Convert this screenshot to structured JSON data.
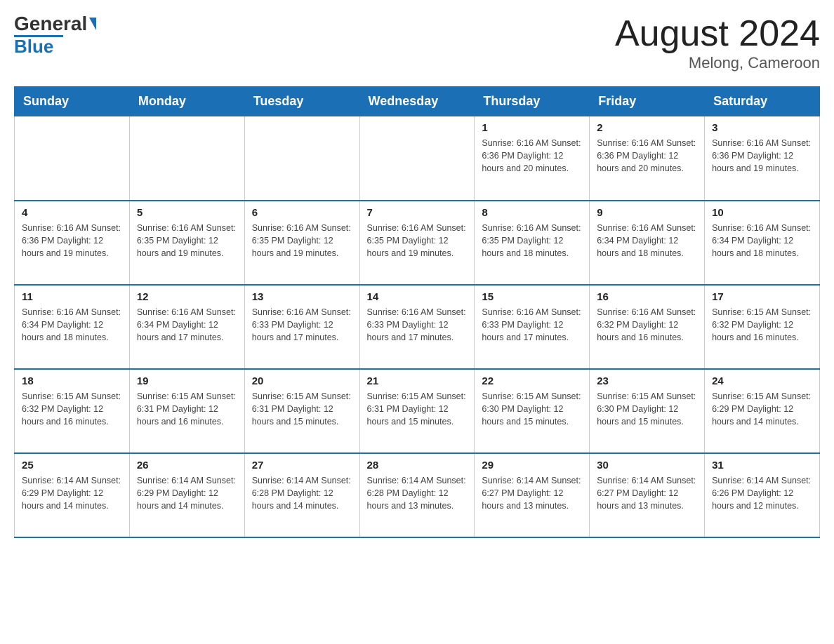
{
  "header": {
    "logo_text1": "General",
    "logo_text2": "Blue",
    "title": "August 2024",
    "subtitle": "Melong, Cameroon"
  },
  "days_of_week": [
    "Sunday",
    "Monday",
    "Tuesday",
    "Wednesday",
    "Thursday",
    "Friday",
    "Saturday"
  ],
  "weeks": [
    [
      {
        "day": "",
        "info": ""
      },
      {
        "day": "",
        "info": ""
      },
      {
        "day": "",
        "info": ""
      },
      {
        "day": "",
        "info": ""
      },
      {
        "day": "1",
        "info": "Sunrise: 6:16 AM\nSunset: 6:36 PM\nDaylight: 12 hours and 20 minutes."
      },
      {
        "day": "2",
        "info": "Sunrise: 6:16 AM\nSunset: 6:36 PM\nDaylight: 12 hours and 20 minutes."
      },
      {
        "day": "3",
        "info": "Sunrise: 6:16 AM\nSunset: 6:36 PM\nDaylight: 12 hours and 19 minutes."
      }
    ],
    [
      {
        "day": "4",
        "info": "Sunrise: 6:16 AM\nSunset: 6:36 PM\nDaylight: 12 hours and 19 minutes."
      },
      {
        "day": "5",
        "info": "Sunrise: 6:16 AM\nSunset: 6:35 PM\nDaylight: 12 hours and 19 minutes."
      },
      {
        "day": "6",
        "info": "Sunrise: 6:16 AM\nSunset: 6:35 PM\nDaylight: 12 hours and 19 minutes."
      },
      {
        "day": "7",
        "info": "Sunrise: 6:16 AM\nSunset: 6:35 PM\nDaylight: 12 hours and 19 minutes."
      },
      {
        "day": "8",
        "info": "Sunrise: 6:16 AM\nSunset: 6:35 PM\nDaylight: 12 hours and 18 minutes."
      },
      {
        "day": "9",
        "info": "Sunrise: 6:16 AM\nSunset: 6:34 PM\nDaylight: 12 hours and 18 minutes."
      },
      {
        "day": "10",
        "info": "Sunrise: 6:16 AM\nSunset: 6:34 PM\nDaylight: 12 hours and 18 minutes."
      }
    ],
    [
      {
        "day": "11",
        "info": "Sunrise: 6:16 AM\nSunset: 6:34 PM\nDaylight: 12 hours and 18 minutes."
      },
      {
        "day": "12",
        "info": "Sunrise: 6:16 AM\nSunset: 6:34 PM\nDaylight: 12 hours and 17 minutes."
      },
      {
        "day": "13",
        "info": "Sunrise: 6:16 AM\nSunset: 6:33 PM\nDaylight: 12 hours and 17 minutes."
      },
      {
        "day": "14",
        "info": "Sunrise: 6:16 AM\nSunset: 6:33 PM\nDaylight: 12 hours and 17 minutes."
      },
      {
        "day": "15",
        "info": "Sunrise: 6:16 AM\nSunset: 6:33 PM\nDaylight: 12 hours and 17 minutes."
      },
      {
        "day": "16",
        "info": "Sunrise: 6:16 AM\nSunset: 6:32 PM\nDaylight: 12 hours and 16 minutes."
      },
      {
        "day": "17",
        "info": "Sunrise: 6:15 AM\nSunset: 6:32 PM\nDaylight: 12 hours and 16 minutes."
      }
    ],
    [
      {
        "day": "18",
        "info": "Sunrise: 6:15 AM\nSunset: 6:32 PM\nDaylight: 12 hours and 16 minutes."
      },
      {
        "day": "19",
        "info": "Sunrise: 6:15 AM\nSunset: 6:31 PM\nDaylight: 12 hours and 16 minutes."
      },
      {
        "day": "20",
        "info": "Sunrise: 6:15 AM\nSunset: 6:31 PM\nDaylight: 12 hours and 15 minutes."
      },
      {
        "day": "21",
        "info": "Sunrise: 6:15 AM\nSunset: 6:31 PM\nDaylight: 12 hours and 15 minutes."
      },
      {
        "day": "22",
        "info": "Sunrise: 6:15 AM\nSunset: 6:30 PM\nDaylight: 12 hours and 15 minutes."
      },
      {
        "day": "23",
        "info": "Sunrise: 6:15 AM\nSunset: 6:30 PM\nDaylight: 12 hours and 15 minutes."
      },
      {
        "day": "24",
        "info": "Sunrise: 6:15 AM\nSunset: 6:29 PM\nDaylight: 12 hours and 14 minutes."
      }
    ],
    [
      {
        "day": "25",
        "info": "Sunrise: 6:14 AM\nSunset: 6:29 PM\nDaylight: 12 hours and 14 minutes."
      },
      {
        "day": "26",
        "info": "Sunrise: 6:14 AM\nSunset: 6:29 PM\nDaylight: 12 hours and 14 minutes."
      },
      {
        "day": "27",
        "info": "Sunrise: 6:14 AM\nSunset: 6:28 PM\nDaylight: 12 hours and 14 minutes."
      },
      {
        "day": "28",
        "info": "Sunrise: 6:14 AM\nSunset: 6:28 PM\nDaylight: 12 hours and 13 minutes."
      },
      {
        "day": "29",
        "info": "Sunrise: 6:14 AM\nSunset: 6:27 PM\nDaylight: 12 hours and 13 minutes."
      },
      {
        "day": "30",
        "info": "Sunrise: 6:14 AM\nSunset: 6:27 PM\nDaylight: 12 hours and 13 minutes."
      },
      {
        "day": "31",
        "info": "Sunrise: 6:14 AM\nSunset: 6:26 PM\nDaylight: 12 hours and 12 minutes."
      }
    ]
  ]
}
